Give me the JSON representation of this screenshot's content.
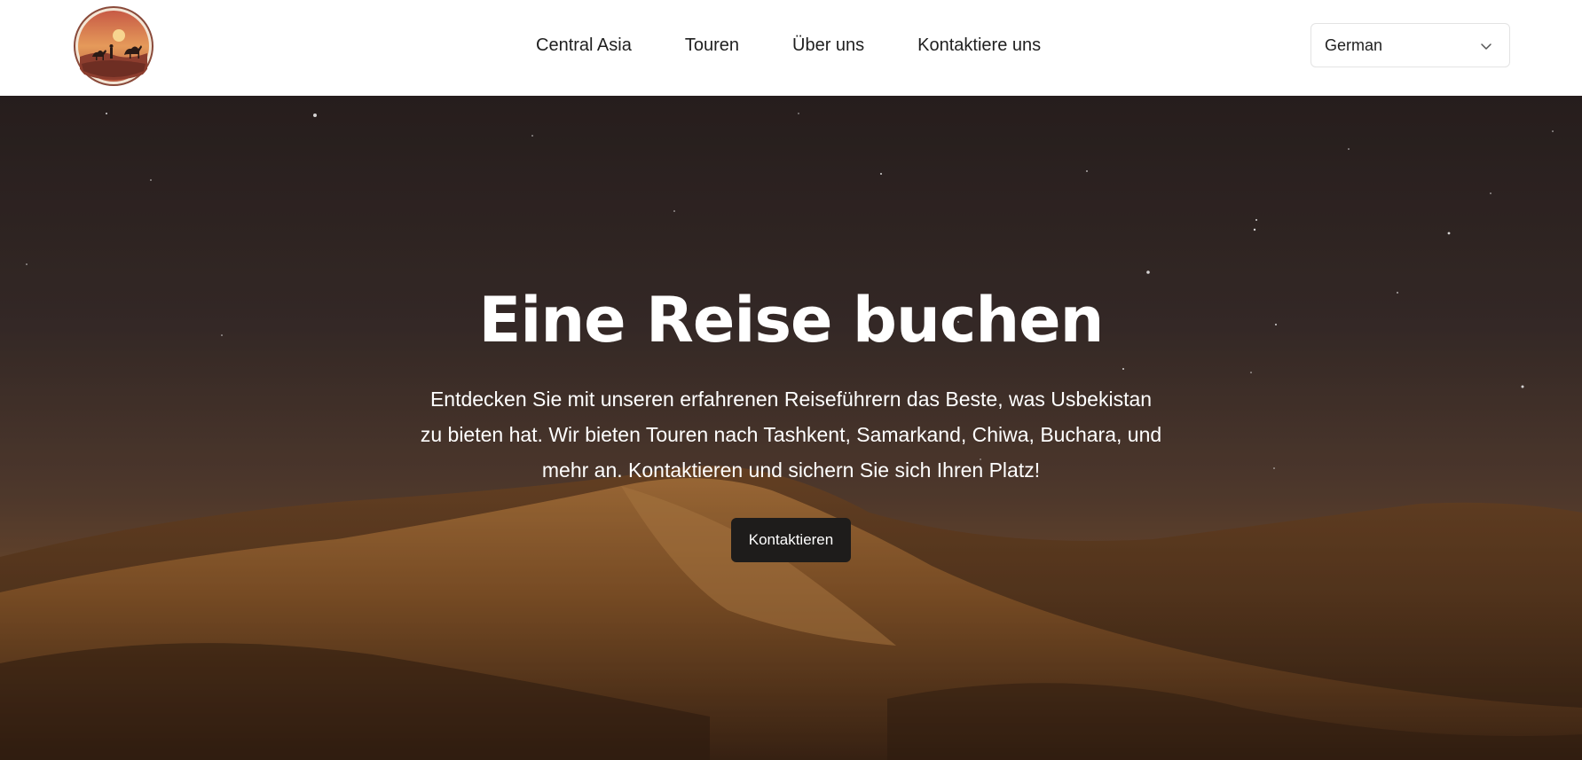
{
  "header": {
    "logo_icon": "desert-caravan-logo",
    "nav": [
      {
        "label": "Central Asia"
      },
      {
        "label": "Touren"
      },
      {
        "label": "Über uns"
      },
      {
        "label": "Kontaktiere uns"
      }
    ],
    "language_select": {
      "value": "German",
      "icon": "chevron-down-icon"
    }
  },
  "hero": {
    "title": "Eine Reise buchen",
    "text": "Entdecken Sie mit unseren erfahrenen Reiseführern das Beste, was Usbekistan zu bieten hat. Wir bieten Touren nach Tashkent, Samarkand, Chiwa, Buchara, und mehr an. Kontaktieren und sichern Sie sich Ihren Platz!",
    "button_label": "Kontaktieren",
    "background": "night-desert-dunes-image"
  },
  "colors": {
    "button_bg": "#1e1c1b",
    "header_bg": "#ffffff",
    "nav_text": "#1f1f1f"
  }
}
